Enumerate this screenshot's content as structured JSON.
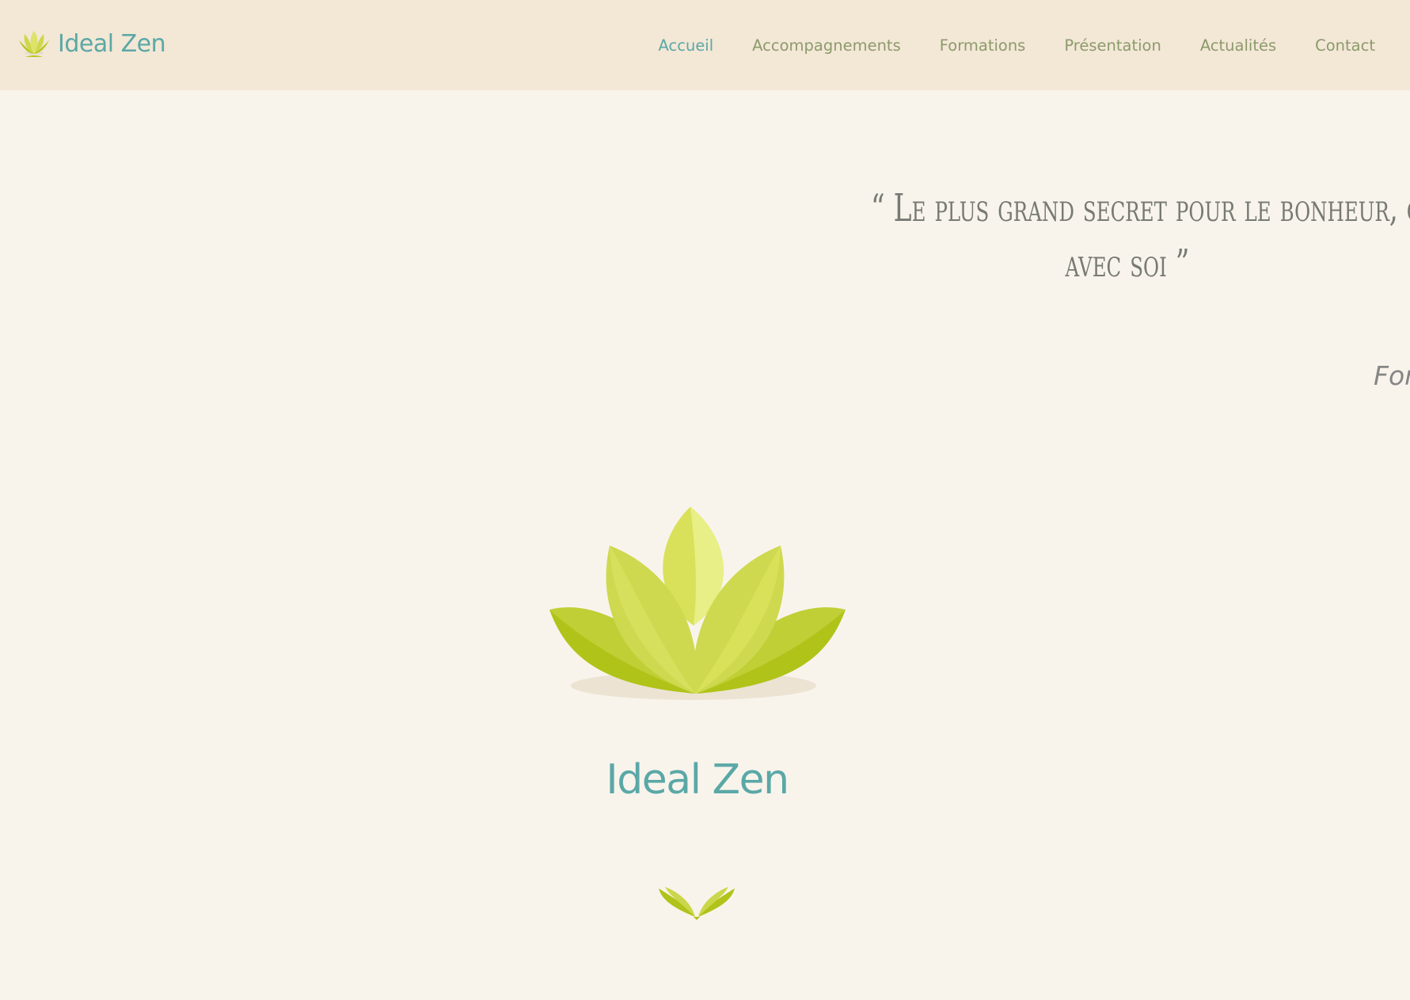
{
  "header": {
    "brand": "Ideal Zen",
    "nav": [
      {
        "label": "Accueil",
        "active": true
      },
      {
        "label": "Accompagnements"
      },
      {
        "label": "Formations"
      },
      {
        "label": "Présentation"
      },
      {
        "label": "Actualités"
      },
      {
        "label": "Contact"
      }
    ]
  },
  "hero": {
    "quote_line1": "“ Le plus grand secret pour le bonheur, c'",
    "quote_line2": "avec soi ”",
    "author": "For",
    "title": "Ideal Zen"
  },
  "colors": {
    "header_bg": "#f3e7d6",
    "page_bg": "#f8f4ec",
    "brand_teal": "#5aa8a6",
    "nav_green": "#8c9a6c",
    "lotus_green": "#b5c81c"
  },
  "icons": {
    "brand": "lotus-icon",
    "hero": "lotus-icon",
    "footer": "hands-leaves-icon"
  }
}
